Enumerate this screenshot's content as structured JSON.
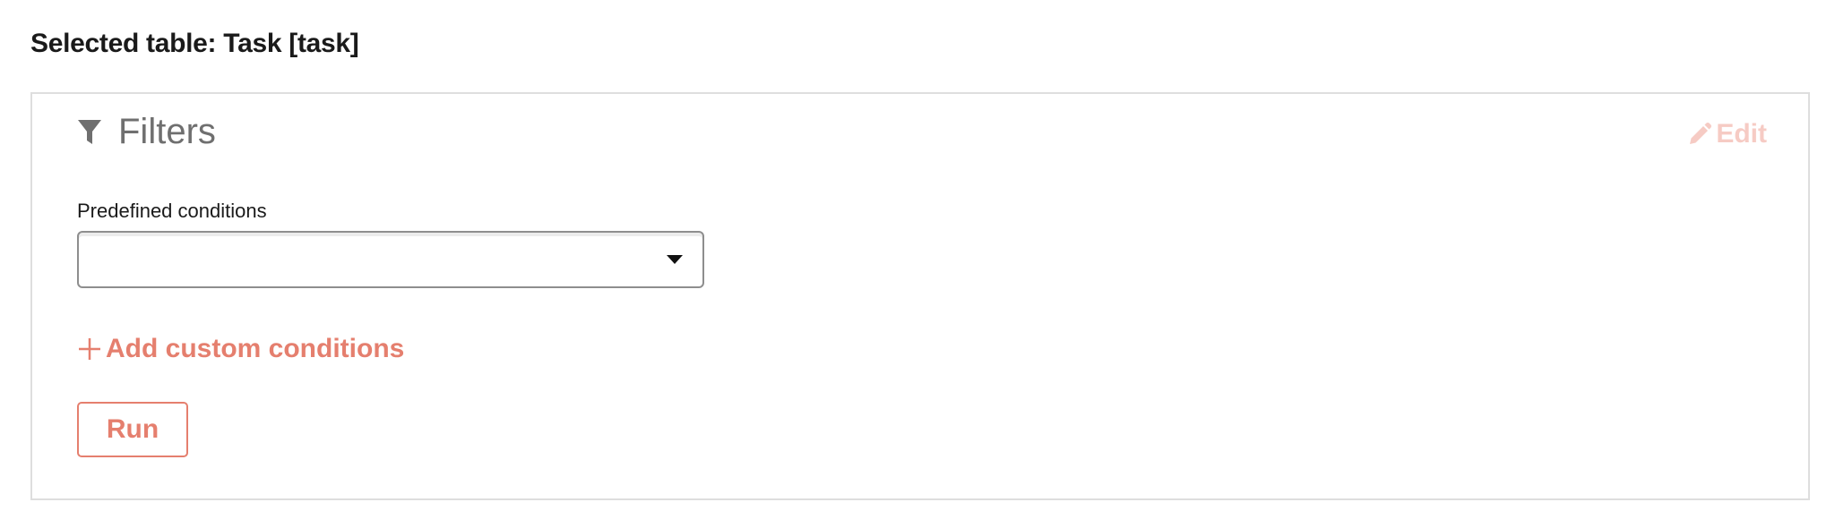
{
  "header": {
    "selected_table_title": "Selected table: Task [task]"
  },
  "filters_panel": {
    "title": "Filters",
    "title_icon": "filter-icon",
    "edit_label": "Edit",
    "edit_icon": "pencil-icon",
    "predefined_conditions": {
      "label": "Predefined conditions",
      "selected_value": "",
      "dropdown_icon": "caret-down-icon"
    },
    "add_custom_conditions_label": "Add custom conditions",
    "add_icon": "plus-icon",
    "run_label": "Run"
  },
  "colors": {
    "accent": "#e57f6e",
    "accent_disabled": "#f6cbc4",
    "panel_border": "#dedede",
    "muted_text": "#6f6f6f",
    "text": "#1a1a1a"
  }
}
